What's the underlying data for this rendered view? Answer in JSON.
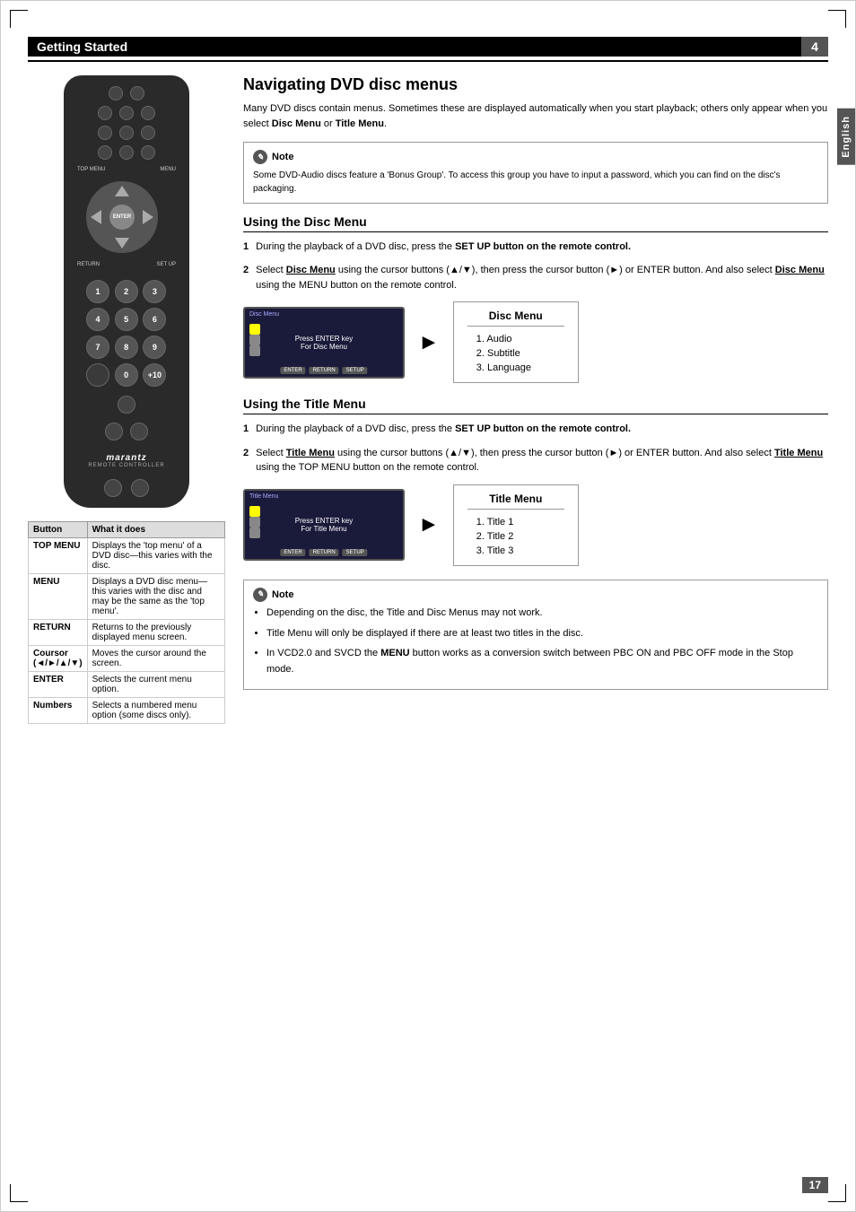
{
  "header": {
    "title": "Getting Started",
    "page_number": "4",
    "page_number_bottom": "17"
  },
  "side_tab": {
    "label": "English"
  },
  "remote": {
    "brand": "marantz",
    "subtitle": "REMOTE CONTROLLER",
    "dpad_center": "ENTER",
    "labels": {
      "top_menu": "TOP MENU",
      "menu": "MENU",
      "return": "RETURN",
      "setup": "SET UP"
    },
    "numpad": [
      "1",
      "2",
      "3",
      "4",
      "5",
      "6",
      "7",
      "8",
      "9",
      "",
      "0",
      "+10"
    ]
  },
  "button_table": {
    "col1": "Button",
    "col2": "What it does",
    "rows": [
      {
        "button": "TOP MENU",
        "description": "Displays the 'top menu' of a DVD disc—this varies with the disc."
      },
      {
        "button": "MENU",
        "description": "Displays a DVD disc menu—this varies with the disc and may be the same as the 'top menu'."
      },
      {
        "button": "RETURN",
        "description": "Returns to the previously displayed menu screen."
      },
      {
        "button": "Coursor\n(◄/►/▲/▼)",
        "description": "Moves the cursor around the screen."
      },
      {
        "button": "ENTER",
        "description": "Selects the current menu option."
      },
      {
        "button": "Numbers",
        "description": "Selects a numbered menu option (some discs only)."
      }
    ]
  },
  "main_section": {
    "title": "Navigating DVD disc menus",
    "intro": "Many DVD discs contain menus. Sometimes these are displayed automatically when you start playback; others only appear when you select Disc Menu or Title Menu.",
    "note": {
      "label": "Note",
      "text": "Some DVD-Audio discs feature a 'Bonus Group'. To access this group you have to input a password, which you can find on the disc's packaging."
    }
  },
  "disc_menu_section": {
    "title": "Using the Disc Menu",
    "step1": "During the playback of a DVD disc, press the SET UP button on the remote control.",
    "step2_prefix": "Select",
    "step2_bold1": "Disc Menu",
    "step2_mid": "using the cursor buttons (▲/▼), then press the cursor button (►) or ENTER button. And also select",
    "step2_bold2": "Disc Menu",
    "step2_suffix": "using the MENU button on the remote control.",
    "demo_screen_label": "Disc Menu",
    "demo_screen_msg": "Press ENTER key",
    "demo_screen_msg2": "For Disc Menu",
    "demo_btn1": "ENTER",
    "demo_btn2": "RETURN",
    "demo_btn3": "SETUP",
    "result_title": "Disc Menu",
    "result_items": [
      "1.  Audio",
      "2.  Subtitle",
      "3.  Language"
    ]
  },
  "title_menu_section": {
    "title": "Using the Title Menu",
    "step1": "During the playback of a DVD disc, press the SET UP button on the remote control.",
    "step2_prefix": "Select",
    "step2_bold1": "Title Menu",
    "step2_mid": "using the cursor buttons (▲/▼), then press the cursor button (►) or ENTER button. And also select",
    "step2_bold2": "Title Menu",
    "step2_suffix": "using the TOP MENU button on the remote control.",
    "demo_screen_label": "Title Menu",
    "demo_screen_msg": "Press ENTER key",
    "demo_screen_msg2": "For Title Menu",
    "demo_btn1": "ENTER",
    "demo_btn2": "RETURN",
    "demo_btn3": "SETUP",
    "result_title": "Title Menu",
    "result_items": [
      "1.  Title 1",
      "2.  Title 2",
      "3.  Title 3"
    ]
  },
  "bottom_note": {
    "label": "Note",
    "bullets": [
      "Depending on the disc, the Title and Disc Menus may not work.",
      "Title Menu will only be displayed if there are at least two titles in the disc.",
      "In VCD2.0 and SVCD the MENU button works as a conversion switch between PBC ON and PBC OFF mode in the Stop mode."
    ]
  }
}
